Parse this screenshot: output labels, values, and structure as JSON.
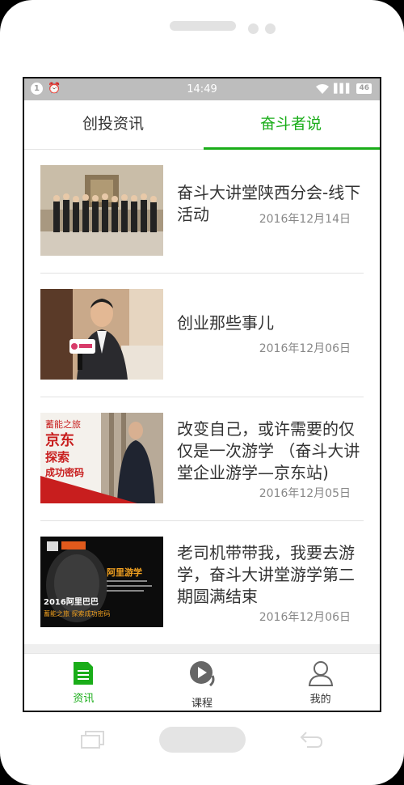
{
  "status_bar": {
    "time": "14:49",
    "notification_count": "1",
    "battery": "46"
  },
  "tabs": [
    {
      "label": "创投资讯",
      "active": false
    },
    {
      "label": "奋斗者说",
      "active": true
    }
  ],
  "articles": [
    {
      "title": "奋斗大讲堂陕西分会-线下活动",
      "date": "2016年12月14日",
      "thumb": "group-photo"
    },
    {
      "title": "创业那些事儿",
      "date": "2016年12月06日",
      "thumb": "interview-photo"
    },
    {
      "title": "改变自己，或许需要的仅仅是一次游学 （奋斗大讲堂企业游学—京东站)",
      "date": "2016年12月05日",
      "thumb": "jd-poster",
      "thumb_text": [
        "蓄能之旅",
        "京东",
        "探索",
        "成功密码"
      ]
    },
    {
      "title": "老司机带带我，我要去游学，奋斗大讲堂游学第二期圆满结束",
      "date": "2016年12月06日",
      "thumb": "alibaba-poster",
      "thumb_text": [
        "阿里游学",
        "2016阿里巴巴",
        "蓄能之旅 探索成功密码"
      ]
    }
  ],
  "bottom_nav": [
    {
      "label": "资讯",
      "icon": "news-icon",
      "active": true
    },
    {
      "label": "课程",
      "icon": "course-play-icon",
      "active": false
    },
    {
      "label": "我的",
      "icon": "profile-icon",
      "active": false
    }
  ],
  "colors": {
    "accent": "#1aad19",
    "status_bar": "#bdbdbd"
  }
}
